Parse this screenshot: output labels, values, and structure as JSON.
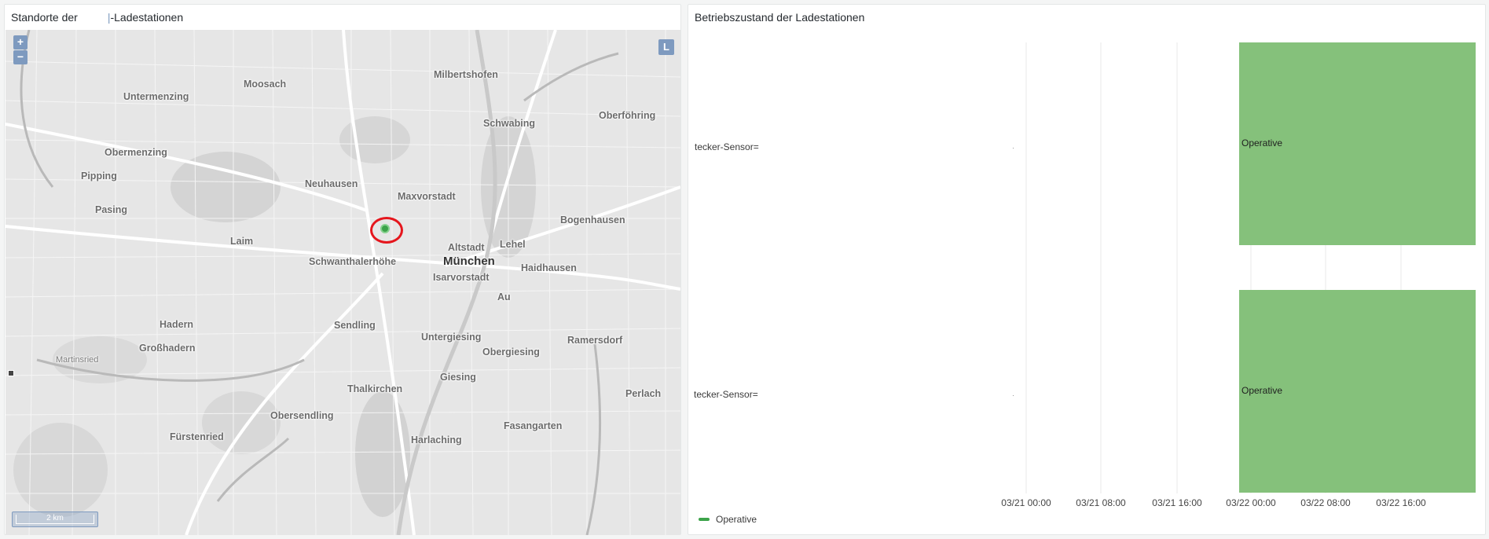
{
  "map_panel": {
    "title": "Standorte der",
    "title_suffix": "-Ladestationen",
    "zoom_in": "+",
    "zoom_out": "−",
    "layer_switch": "L",
    "scale": "2 km",
    "places": [
      {
        "name": "Moosach"
      },
      {
        "name": "Milbertshofen"
      },
      {
        "name": "Untermenzing"
      },
      {
        "name": "Oberföhring"
      },
      {
        "name": "Schwabing"
      },
      {
        "name": "Obermenzing"
      },
      {
        "name": "Pipping"
      },
      {
        "name": "Neuhausen"
      },
      {
        "name": "Maxvorstadt"
      },
      {
        "name": "Pasing"
      },
      {
        "name": "Bogenhausen"
      },
      {
        "name": "Laim"
      },
      {
        "name": "Altstadt"
      },
      {
        "name": "Lehel"
      },
      {
        "name": "Schwanthalerhöhe"
      },
      {
        "name": "München"
      },
      {
        "name": "Haidhausen"
      },
      {
        "name": "Isarvorstadt"
      },
      {
        "name": "Au"
      },
      {
        "name": "Hadern"
      },
      {
        "name": "Sendling"
      },
      {
        "name": "Großhadern"
      },
      {
        "name": "Untergiesing"
      },
      {
        "name": "Ramersdorf"
      },
      {
        "name": "Obergiesing"
      },
      {
        "name": "Martinsried"
      },
      {
        "name": "Giesing"
      },
      {
        "name": "Thalkirchen"
      },
      {
        "name": "Perlach"
      },
      {
        "name": "Obersendling"
      },
      {
        "name": "Fasangarten"
      },
      {
        "name": "Fürstenried"
      },
      {
        "name": "Harlaching"
      }
    ]
  },
  "state_panel": {
    "title": "Betriebszustand der Ladestationen",
    "rows": [
      {
        "label": "tecker-Sensor=",
        "state": "Operative",
        "start": "03/22 00:00",
        "end": "03/22 23:59"
      },
      {
        "label": "tecker-Sensor=",
        "state": "Operative",
        "start": "03/22 00:00",
        "end": "03/22 23:59"
      }
    ],
    "x_ticks": [
      "03/21 00:00",
      "03/21 08:00",
      "03/21 16:00",
      "03/22 00:00",
      "03/22 08:00",
      "03/22 16:00"
    ],
    "legend": [
      {
        "name": "Operative",
        "color": "#3ca34a"
      }
    ],
    "bar_color": "#85c17b"
  }
}
